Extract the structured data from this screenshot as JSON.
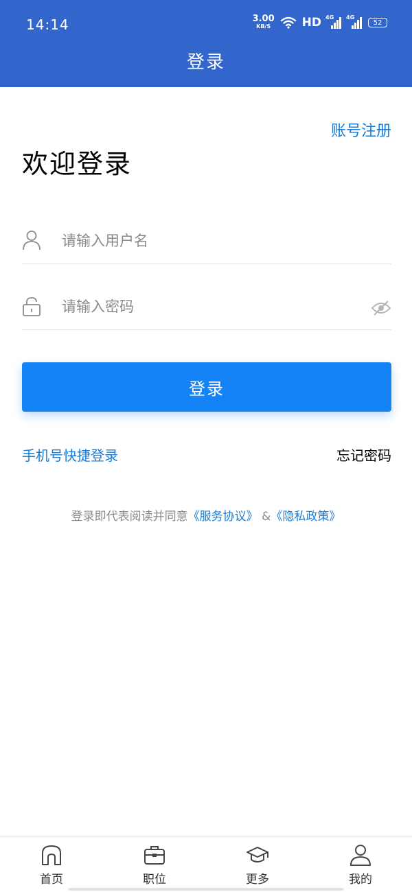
{
  "status_bar": {
    "time": "14:14",
    "net_speed_value": "3.00",
    "net_speed_unit": "KB/S",
    "hd_label": "HD",
    "signal1_tag": "4G",
    "signal2_tag": "4G",
    "battery": "52"
  },
  "header": {
    "title": "登录"
  },
  "login": {
    "register_link": "账号注册",
    "welcome": "欢迎登录",
    "username_placeholder": "请输入用户名",
    "password_placeholder": "请输入密码",
    "submit_label": "登录",
    "quick_login": "手机号快捷登录",
    "forgot_password": "忘记密码"
  },
  "agreement": {
    "prefix": "登录即代表阅读并同意",
    "service_link": "《服务协议》",
    "connector": " &",
    "privacy_link": "《隐私政策》"
  },
  "tabbar": {
    "items": [
      {
        "label": "首页",
        "icon": "home-icon"
      },
      {
        "label": "职位",
        "icon": "briefcase-icon"
      },
      {
        "label": "更多",
        "icon": "graduation-cap-icon"
      },
      {
        "label": "我的",
        "icon": "user-icon"
      }
    ]
  },
  "colors": {
    "header_bg": "#3366cc",
    "primary_button": "#1483f5",
    "link": "#1a7cd6",
    "placeholder": "#8a8a8a"
  }
}
